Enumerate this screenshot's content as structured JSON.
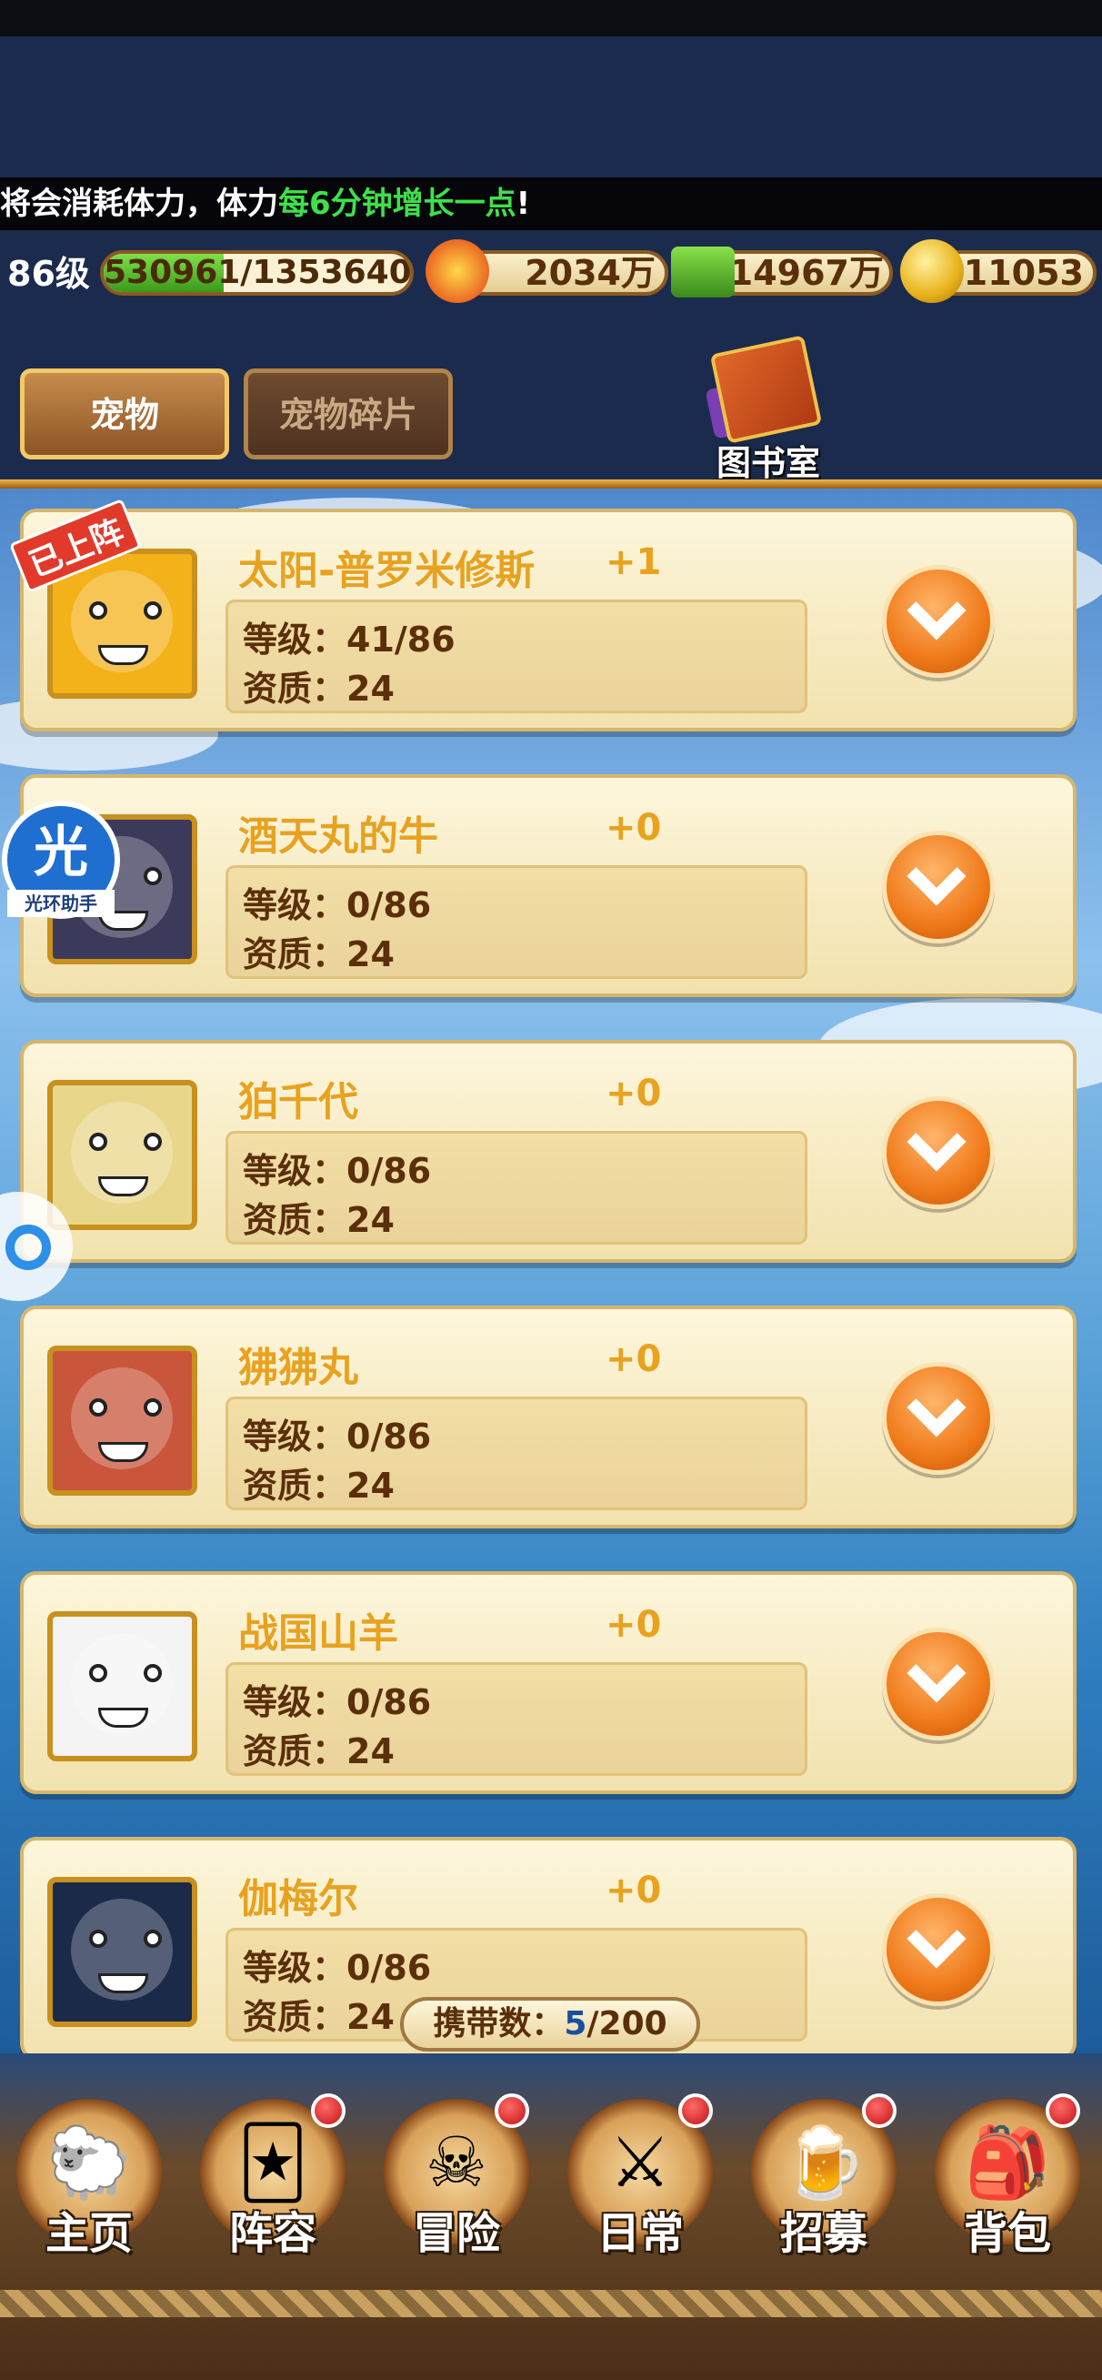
{
  "ticker": {
    "prefix": "将会消耗体力，体力",
    "highlight": "每6分钟增长一点",
    "suffix": "!"
  },
  "status": {
    "level": "86级",
    "exp_text": "530961/1353640",
    "exp_fraction": 0.392,
    "power": "2034万",
    "cash": "114967万",
    "gold": "11053"
  },
  "tabs": [
    {
      "label": "宠物",
      "active": true
    },
    {
      "label": "宠物碎片",
      "active": false
    }
  ],
  "library_label": "图书室",
  "pets": [
    {
      "name": "太阳-普罗米修斯",
      "plus": "+1",
      "level": "41/86",
      "quality": "24",
      "deployed": true,
      "deployed_label": "已上阵",
      "color": "#f4b21a"
    },
    {
      "name": "酒天丸的牛",
      "plus": "+0",
      "level": "0/86",
      "quality": "24",
      "deployed": false,
      "color": "#3b3a5a"
    },
    {
      "name": "狛千代",
      "plus": "+0",
      "level": "0/86",
      "quality": "24",
      "deployed": false,
      "color": "#e8d68a"
    },
    {
      "name": "狒狒丸",
      "plus": "+0",
      "level": "0/86",
      "quality": "24",
      "deployed": false,
      "color": "#c9553a"
    },
    {
      "name": "战国山羊",
      "plus": "+0",
      "level": "0/86",
      "quality": "24",
      "deployed": false,
      "color": "#f4f4f4"
    },
    {
      "name": "伽梅尔",
      "plus": "+0",
      "level": "0/86",
      "quality": "24",
      "deployed": false,
      "color": "#1c2a4a"
    }
  ],
  "labels": {
    "level": "等级：",
    "quality": "资质："
  },
  "carry": {
    "label": "携带数：",
    "count": "5",
    "max": "/200"
  },
  "helper": {
    "big": "光",
    "small": "光环助手"
  },
  "nav": [
    {
      "label": "主页",
      "icon": "home-icon",
      "glyph": "🐑",
      "badge": false
    },
    {
      "label": "阵容",
      "icon": "lineup-icon",
      "glyph": "🃏",
      "badge": true
    },
    {
      "label": "冒险",
      "icon": "skull-icon",
      "glyph": "☠",
      "badge": true
    },
    {
      "label": "日常",
      "icon": "swords-icon",
      "glyph": "⚔",
      "badge": true
    },
    {
      "label": "招募",
      "icon": "tavern-icon",
      "glyph": "🍺",
      "badge": true
    },
    {
      "label": "背包",
      "icon": "bag-icon",
      "glyph": "🎒",
      "badge": true
    }
  ]
}
